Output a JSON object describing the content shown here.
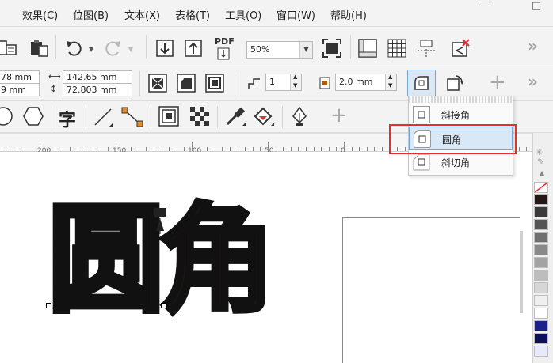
{
  "menu": {
    "items": [
      {
        "label": "效果(C)",
        "key": "effects"
      },
      {
        "label": "位图(B)",
        "key": "bitmaps"
      },
      {
        "label": "文本(X)",
        "key": "text"
      },
      {
        "label": "表格(T)",
        "key": "table"
      },
      {
        "label": "工具(O)",
        "key": "tools"
      },
      {
        "label": "窗口(W)",
        "key": "window"
      },
      {
        "label": "帮助(H)",
        "key": "help"
      }
    ],
    "window_controls": [
      "—",
      "□"
    ]
  },
  "toolbar": {
    "zoom_value": "50%",
    "pdf_label": "PDF"
  },
  "property_bar": {
    "x_pos": "78 mm",
    "y_pos": "9 mm",
    "width": "142.65 mm",
    "height": "72.803 mm",
    "corner_count": "1",
    "corner_size": "2.0 mm"
  },
  "toolbox": {
    "text_tool_glyph": "字"
  },
  "ruler": {
    "labels": [
      "200",
      "150",
      "100",
      "50",
      "0"
    ]
  },
  "canvas": {
    "char1": "圆",
    "char2": "角"
  },
  "corner_menu": {
    "items": [
      {
        "label": "斜接角",
        "icon": "miter-corner-icon"
      },
      {
        "label": "圆角",
        "icon": "round-corner-icon"
      },
      {
        "label": "斜切角",
        "icon": "bevel-corner-icon"
      }
    ],
    "selected_index": 1
  },
  "colors": {
    "accent": "#0078d7",
    "highlight": "#e0312f",
    "text_fill": "#231815"
  }
}
